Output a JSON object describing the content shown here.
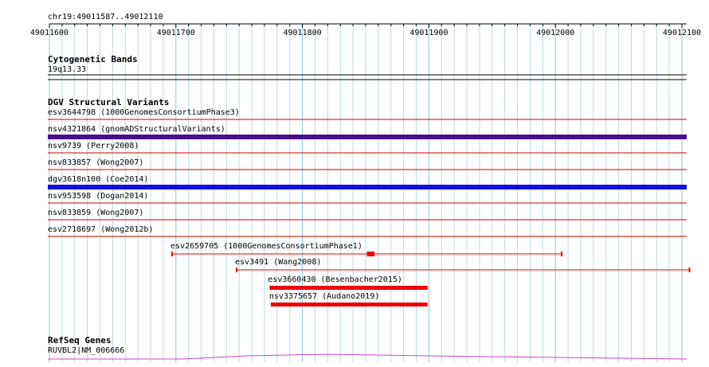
{
  "location": "chr19:49011587..49012110",
  "ruler": {
    "ticks": [
      {
        "pos": 49011600,
        "label": "49011600"
      },
      {
        "pos": 49011700,
        "label": "49011700"
      },
      {
        "pos": 49011800,
        "label": "49011800"
      },
      {
        "pos": 49011900,
        "label": "49011900"
      },
      {
        "pos": 49012000,
        "label": "49012000"
      },
      {
        "pos": 49012100,
        "label": "49012100"
      }
    ]
  },
  "cytoband": {
    "title": "Cytogenetic Bands",
    "band_label": "19q13.33"
  },
  "dgv": {
    "title": "DGV Structural Variants",
    "full_rows": [
      {
        "label": "esv3644798 (1000GenomesConsortiumPhase3)",
        "color": "#cc0000",
        "style": "thin"
      },
      {
        "label": "nsv4321864 (gnomADStructuralVariants)",
        "color": "#4b0d8c",
        "style": "thick"
      },
      {
        "label": "nsv9739 (Perry2008)",
        "color": "#cc0000",
        "style": "thin"
      },
      {
        "label": "nsv833857 (Wong2007)",
        "color": "#cc0000",
        "style": "thin"
      },
      {
        "label": "dgv3618n100 (Coe2014)",
        "color": "#1010e0",
        "style": "thick"
      },
      {
        "label": "nsv953598 (Dogan2014)",
        "color": "#cc0000",
        "style": "thin"
      },
      {
        "label": "nsv833859 (Wong2007)",
        "color": "#cc0000",
        "style": "thin"
      },
      {
        "label": "esv2718697 (Wong2012b)",
        "color": "#cc0000",
        "style": "thin"
      }
    ],
    "partial_rows": [
      {
        "label": "esv2659705 (1000GenomesConsortiumPhase1)",
        "start": 49011697,
        "end": 49012005,
        "block_start": 49011851,
        "block_end": 49011857,
        "color": "#ee0000",
        "style": "line"
      },
      {
        "label": "esv3491 (Wang2008)",
        "start": 49011748,
        "end": 49012106,
        "color": "#ee0000",
        "style": "line"
      },
      {
        "label": "esv3660430 (Besenbacher2015)",
        "start": 49011774,
        "end": 49011899,
        "color": "#ee0000",
        "style": "bar"
      },
      {
        "label": "nsv3375657 (Audano2019)",
        "start": 49011775,
        "end": 49011899,
        "color": "#ee0000",
        "style": "bar"
      }
    ]
  },
  "refseq": {
    "title": "RefSeq Genes",
    "gene_label": "RUVBL2|NM_006666",
    "color": "#cc44cc"
  },
  "colors": {
    "grid": "#b8dbe8",
    "separator": "#cc2222"
  }
}
